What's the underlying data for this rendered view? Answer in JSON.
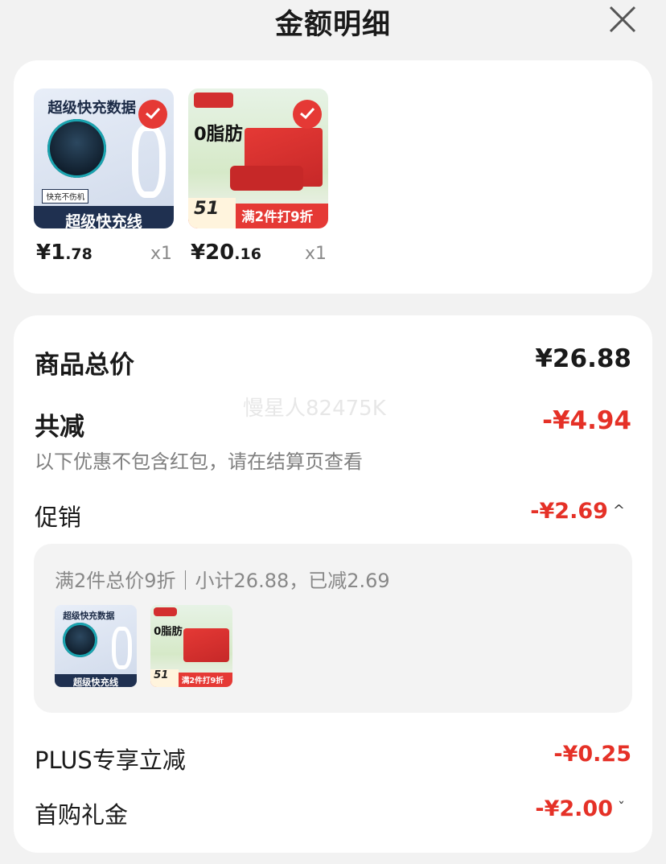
{
  "header": {
    "title": "金额明细"
  },
  "products": [
    {
      "art_text": "超级快充数据",
      "art_band": "超级快充线",
      "art_tag": "快充不伤机",
      "price_int": "¥1",
      "price_dec": ".78",
      "qty": "x1"
    },
    {
      "art_text": "0脂肪",
      "art_band": "满2件打9折",
      "art_tag": "51",
      "price_int": "¥20",
      "price_dec": ".16",
      "qty": "x1"
    }
  ],
  "summary": {
    "total_label": "商品总价",
    "total_value": "¥26.88",
    "discount_label": "共减",
    "discount_value": "-¥4.94",
    "discount_hint": "以下优惠不包含红包，请在结算页查看",
    "promo_label": "促销",
    "promo_value": "-¥2.69",
    "promo_chevron": "^",
    "promo_detail": "满2件总价9折｜小计26.88，已减2.69",
    "plus_label": "PLUS专享立减",
    "plus_value": "-¥0.25",
    "first_label": "首购礼金",
    "first_value": "-¥2.00",
    "first_chevron": "ˇ"
  },
  "watermark": "慢星人82475K",
  "colors": {
    "accent_red": "#e53127",
    "check_red": "#e53935"
  }
}
